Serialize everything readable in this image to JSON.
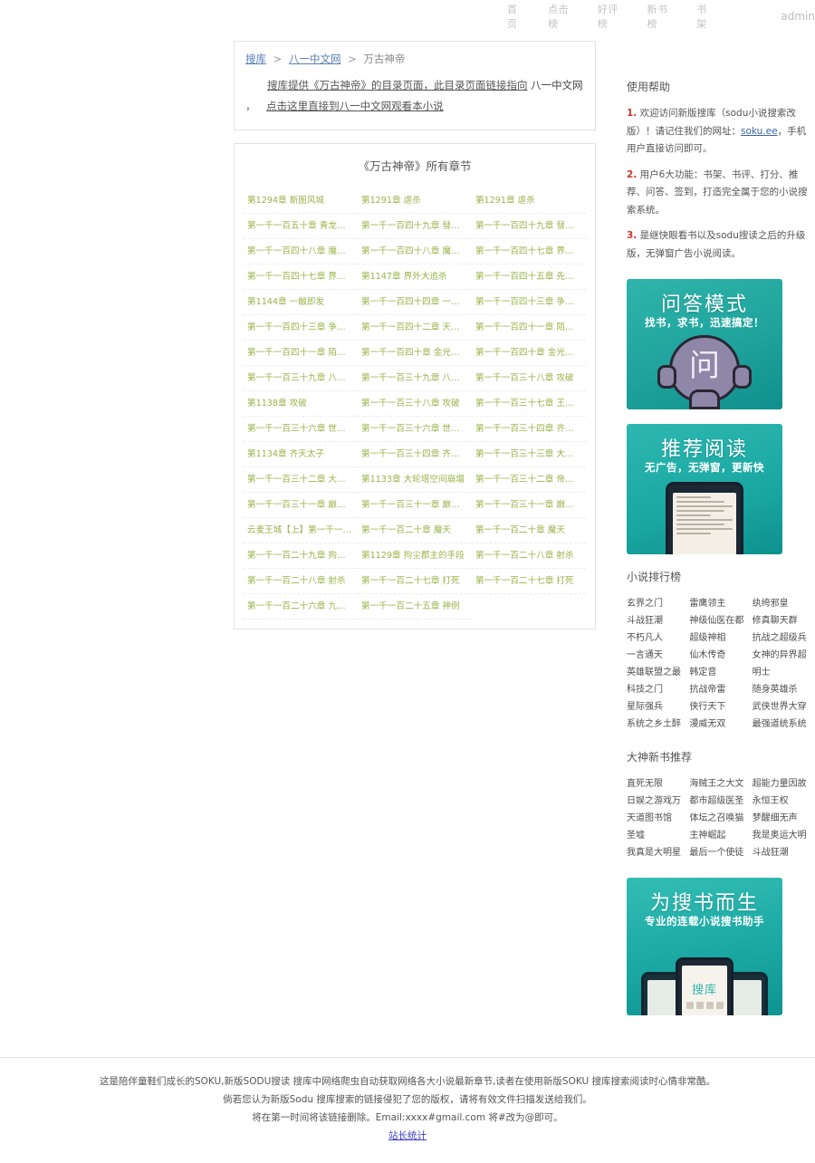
{
  "topnav": {
    "items": [
      "首页",
      "点击榜",
      "好评榜",
      "新书榜",
      "书架"
    ],
    "user": "admin"
  },
  "breadcrumb": {
    "root": "搜库",
    "site": "八一中文网",
    "book": "万古神帝",
    "sep": ">"
  },
  "intro": {
    "prefix": "搜库提供《万古神帝》的目录页面，此目录页面链接指向",
    "site": "八一中文网",
    "comma": "，",
    "link": "点击这里直接到八一中文网观看本小说"
  },
  "chapters": {
    "title": "《万古神帝》所有章节",
    "items": [
      "第1294章 斯图风城",
      "第1291章 虐杀",
      "第1291章 虐杀",
      "第一千一百五十章 青龙帝君",
      "第一千一百四十九章 彗晕流光",
      "第一千一百四十九章 彗晕流光",
      "第一千一百四十八章 魔丹王妃",
      "第一千一百四十八章 魔丹王妃",
      "第一千一百四十七章 界外大追杀",
      "第一千一百四十七章 界外大追杀",
      "第1147章 界外大追杀",
      "第一千一百四十五章 先前世界之...",
      "第1144章 一触即发",
      "第一千一百四十四章 一触即发",
      "第一千一百四十三章 争夺战",
      "第一千一百四十三章 争夺战",
      "第一千一百四十二章 天地剑阵",
      "第一千一百四十一章 陌尘公主",
      "第一千一百四十一章 陌尘公主",
      "第一千一百四十章 金光宝袋",
      "第一千一百四十章 金光宝袋",
      "第一千一百三十九章 八龙武圣",
      "第一千一百三十九章 八龙武圣",
      "第一千一百三十八章 攻破",
      "第1138章 攻破",
      "第一千一百三十八章 攻破",
      "第一千一百三十七章 王都城外",
      "第一千一百三十六章 世间尽无余...",
      "第一千一百三十六章 世间尽无余...",
      "第一千一百三十四章 齐天太子",
      "第1134章 齐天太子",
      "第一千一百三十四章 齐天太子",
      "第一千一百三十三章 大轮塔空间...",
      "第一千一百三十二章 大轮塔空间...",
      "第1133章 大轮塔空间崩塌",
      "第一千一百三十二章 帝尘罡剑",
      "第一千一百三十一章 巅峰之战",
      "第一千一百三十一章 巅峰之战",
      "第一千一百三十一章 巅峰之战",
      "云麦王城【上】第一千一百二十...",
      "第一千一百二十章 魔天",
      "第一千一百二十章 魔天",
      "第一千一百二十九章 拘尘郡主的...",
      "第1129章 拘尘郡主的手段",
      "第一千一百二十八章 射杀",
      "第一千一百二十八章 射杀",
      "第一千一百二十七章 打死",
      "第一千一百二十七章 打死",
      "第一千一百二十六章 九阶半圣",
      "第一千一百二十五章 神例"
    ]
  },
  "help": {
    "title": "使用帮助",
    "items": [
      {
        "num": "1.",
        "text_before": "欢迎访问新版搜库（sodu小说搜索改版）！请记住我们的网址：",
        "link": "soku.ee",
        "text_after": "，手机用户直接访问即可。"
      },
      {
        "num": "2.",
        "text_before": "用户6大功能：书架、书评、打分、推荐、问答、签到，打造完全属于您的小说搜索系统。",
        "link": "",
        "text_after": ""
      },
      {
        "num": "3.",
        "text_before": "是继快眼看书以及sodu搜读之后的升级版，无弹窗广告小说阅读。",
        "link": "",
        "text_after": ""
      }
    ]
  },
  "banners": [
    {
      "id": "qa",
      "title": "问答模式",
      "subtitle": "找书，求书，迅速搞定！",
      "glyph": "问"
    },
    {
      "id": "recommend",
      "title": "推荐阅读",
      "subtitle": "无广告，无弹窗，更新快",
      "glyph": ""
    },
    {
      "id": "search",
      "title": "为搜书而生",
      "subtitle": "专业的连载小说搜书助手",
      "glyph": "搜库"
    }
  ],
  "rank": {
    "title": "小说排行榜",
    "items": [
      "玄界之门",
      "雷鹰领主",
      "纨绔邪皇",
      "斗战狂潮",
      "神级仙医在都",
      "修真聊天群",
      "不朽凡人",
      "超级神相",
      "抗战之超级兵",
      "一言通天",
      "仙木传奇",
      "女神的异界超",
      "英雄联盟之最",
      "韩定音",
      "明士",
      "科技之门",
      "抗战帝雷",
      "随身英雄杀",
      "星际强兵",
      "侠行天下",
      "武侠世界大穿",
      "系统之乡土醉",
      "漫威无双",
      "最强道统系统"
    ]
  },
  "newbook": {
    "title": "大神新书推荐",
    "items": [
      "直死无限",
      "海贼王之大文",
      "超能力量因故",
      "日娱之游戏万",
      "都市超级医圣",
      "永恒王权",
      "天道图书馆",
      "体坛之召唤猫",
      "梦醒细无声",
      "圣墟",
      "主神崛起",
      "我是奥运大明",
      "我真是大明星",
      "最后一个使徒",
      "斗战狂潮"
    ]
  },
  "footer": {
    "line1": "这是陪伴童鞋们成长的SOKU,新版SODU搜读 搜库中网络爬虫自动获取网络各大小说最新章节,读者在使用新版SOKU 搜库搜索阅读时心情非常酷。",
    "line2": "倘若您认为新版Sodu 搜库搜索的链接侵犯了您的版权，请将有效文件扫描发送给我们。",
    "line3": "将在第一时间将该链接删除。Email:xxxx#gmail.com 将#改为@即可。",
    "link": "站长统计"
  }
}
